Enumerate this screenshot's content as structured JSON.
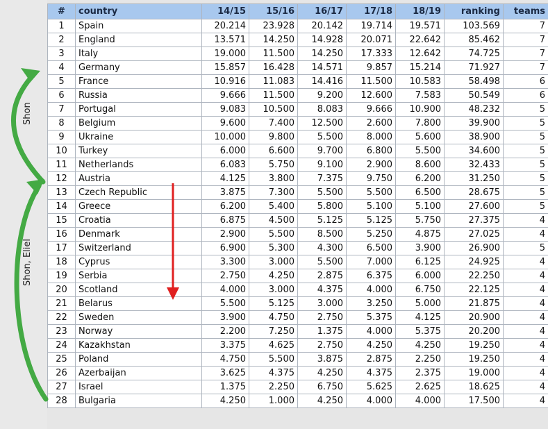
{
  "annotations": {
    "group1_label": "Shon",
    "group2_label": "Shon, Eliel",
    "arrow_color": "#44aa44",
    "red_arrow_color": "#e02020"
  },
  "table": {
    "columns": [
      "#",
      "country",
      "14/15",
      "15/16",
      "16/17",
      "17/18",
      "18/19",
      "ranking",
      "teams"
    ],
    "rows": [
      [
        "1",
        "Spain",
        "20.214",
        "23.928",
        "20.142",
        "19.714",
        "19.571",
        "103.569",
        "7"
      ],
      [
        "2",
        "England",
        "13.571",
        "14.250",
        "14.928",
        "20.071",
        "22.642",
        "85.462",
        "7"
      ],
      [
        "3",
        "Italy",
        "19.000",
        "11.500",
        "14.250",
        "17.333",
        "12.642",
        "74.725",
        "7"
      ],
      [
        "4",
        "Germany",
        "15.857",
        "16.428",
        "14.571",
        "9.857",
        "15.214",
        "71.927",
        "7"
      ],
      [
        "5",
        "France",
        "10.916",
        "11.083",
        "14.416",
        "11.500",
        "10.583",
        "58.498",
        "6"
      ],
      [
        "6",
        "Russia",
        "9.666",
        "11.500",
        "9.200",
        "12.600",
        "7.583",
        "50.549",
        "6"
      ],
      [
        "7",
        "Portugal",
        "9.083",
        "10.500",
        "8.083",
        "9.666",
        "10.900",
        "48.232",
        "5"
      ],
      [
        "8",
        "Belgium",
        "9.600",
        "7.400",
        "12.500",
        "2.600",
        "7.800",
        "39.900",
        "5"
      ],
      [
        "9",
        "Ukraine",
        "10.000",
        "9.800",
        "5.500",
        "8.000",
        "5.600",
        "38.900",
        "5"
      ],
      [
        "10",
        "Turkey",
        "6.000",
        "6.600",
        "9.700",
        "6.800",
        "5.500",
        "34.600",
        "5"
      ],
      [
        "11",
        "Netherlands",
        "6.083",
        "5.750",
        "9.100",
        "2.900",
        "8.600",
        "32.433",
        "5"
      ],
      [
        "12",
        "Austria",
        "4.125",
        "3.800",
        "7.375",
        "9.750",
        "6.200",
        "31.250",
        "5"
      ],
      [
        "13",
        "Czech Republic",
        "3.875",
        "7.300",
        "5.500",
        "5.500",
        "6.500",
        "28.675",
        "5"
      ],
      [
        "14",
        "Greece",
        "6.200",
        "5.400",
        "5.800",
        "5.100",
        "5.100",
        "27.600",
        "5"
      ],
      [
        "15",
        "Croatia",
        "6.875",
        "4.500",
        "5.125",
        "5.125",
        "5.750",
        "27.375",
        "4"
      ],
      [
        "16",
        "Denmark",
        "2.900",
        "5.500",
        "8.500",
        "5.250",
        "4.875",
        "27.025",
        "4"
      ],
      [
        "17",
        "Switzerland",
        "6.900",
        "5.300",
        "4.300",
        "6.500",
        "3.900",
        "26.900",
        "5"
      ],
      [
        "18",
        "Cyprus",
        "3.300",
        "3.000",
        "5.500",
        "7.000",
        "6.125",
        "24.925",
        "4"
      ],
      [
        "19",
        "Serbia",
        "2.750",
        "4.250",
        "2.875",
        "6.375",
        "6.000",
        "22.250",
        "4"
      ],
      [
        "20",
        "Scotland",
        "4.000",
        "3.000",
        "4.375",
        "4.000",
        "6.750",
        "22.125",
        "4"
      ],
      [
        "21",
        "Belarus",
        "5.500",
        "5.125",
        "3.000",
        "3.250",
        "5.000",
        "21.875",
        "4"
      ],
      [
        "22",
        "Sweden",
        "3.900",
        "4.750",
        "2.750",
        "5.375",
        "4.125",
        "20.900",
        "4"
      ],
      [
        "23",
        "Norway",
        "2.200",
        "7.250",
        "1.375",
        "4.000",
        "5.375",
        "20.200",
        "4"
      ],
      [
        "24",
        "Kazakhstan",
        "3.375",
        "4.625",
        "2.750",
        "4.250",
        "4.250",
        "19.250",
        "4"
      ],
      [
        "25",
        "Poland",
        "4.750",
        "5.500",
        "3.875",
        "2.875",
        "2.250",
        "19.250",
        "4"
      ],
      [
        "26",
        "Azerbaijan",
        "3.625",
        "4.375",
        "4.250",
        "4.375",
        "2.375",
        "19.000",
        "4"
      ],
      [
        "27",
        "Israel",
        "1.375",
        "2.250",
        "6.750",
        "5.625",
        "2.625",
        "18.625",
        "4"
      ],
      [
        "28",
        "Bulgaria",
        "4.250",
        "1.000",
        "4.250",
        "4.000",
        "4.000",
        "17.500",
        "4"
      ]
    ]
  }
}
